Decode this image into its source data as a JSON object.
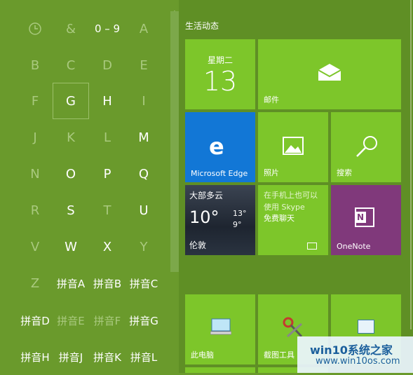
{
  "alphabet_grid": {
    "rows": [
      [
        {
          "t": "clock-icon",
          "dim": true,
          "icon": true
        },
        {
          "t": "&",
          "dim": true
        },
        {
          "t": "0 – 9",
          "dim": false
        },
        {
          "t": "A",
          "dim": true
        }
      ],
      [
        {
          "t": "B",
          "dim": true
        },
        {
          "t": "C",
          "dim": true
        },
        {
          "t": "D",
          "dim": true
        },
        {
          "t": "E",
          "dim": true
        }
      ],
      [
        {
          "t": "F",
          "dim": true
        },
        {
          "t": "G",
          "dim": false,
          "sel": true
        },
        {
          "t": "H",
          "dim": false
        },
        {
          "t": "I",
          "dim": true
        }
      ],
      [
        {
          "t": "J",
          "dim": true
        },
        {
          "t": "K",
          "dim": true
        },
        {
          "t": "L",
          "dim": true
        },
        {
          "t": "M",
          "dim": false
        }
      ],
      [
        {
          "t": "N",
          "dim": true
        },
        {
          "t": "O",
          "dim": false
        },
        {
          "t": "P",
          "dim": false
        },
        {
          "t": "Q",
          "dim": false
        }
      ],
      [
        {
          "t": "R",
          "dim": true
        },
        {
          "t": "S",
          "dim": false
        },
        {
          "t": "T",
          "dim": true
        },
        {
          "t": "U",
          "dim": false
        }
      ],
      [
        {
          "t": "V",
          "dim": true
        },
        {
          "t": "W",
          "dim": false
        },
        {
          "t": "X",
          "dim": false
        },
        {
          "t": "Y",
          "dim": true
        }
      ],
      [
        {
          "t": "Z",
          "dim": true
        },
        {
          "t": "拼音A",
          "dim": false
        },
        {
          "t": "拼音B",
          "dim": false
        },
        {
          "t": "拼音C",
          "dim": false
        }
      ],
      [
        {
          "t": "拼音D",
          "dim": false
        },
        {
          "t": "拼音E",
          "dim": true
        },
        {
          "t": "拼音F",
          "dim": true
        },
        {
          "t": "拼音G",
          "dim": false
        }
      ],
      [
        {
          "t": "拼音H",
          "dim": false
        },
        {
          "t": "拼音J",
          "dim": false
        },
        {
          "t": "拼音K",
          "dim": false
        },
        {
          "t": "拼音L",
          "dim": false
        }
      ]
    ]
  },
  "tiles": {
    "section_title": "生活动态",
    "calendar": {
      "day": "星期二",
      "date": "13"
    },
    "mail": {
      "label": "邮件"
    },
    "edge": {
      "label": "Microsoft Edge"
    },
    "photos": {
      "label": "照片"
    },
    "search": {
      "label": "搜索"
    },
    "weather": {
      "condition": "大部多云",
      "temp": "10°",
      "high": "13°",
      "low": "9°",
      "city": "伦敦"
    },
    "skype": {
      "line1": "在手机上也可以",
      "line2": "使用 Skype",
      "line3": "免费聊天"
    },
    "onenote": {
      "label": "OneNote"
    },
    "this_pc": {
      "label": "此电脑"
    },
    "snipping": {
      "label": "截图工具"
    }
  },
  "watermark": {
    "title": "win10系统之家",
    "url": "www.win10os.com"
  },
  "colors": {
    "bg_left": "#6a9a2c",
    "bg_right": "#5f8f25",
    "tile_green": "#7dc62a",
    "tile_blue": "#1277d6",
    "tile_purple": "#80397b",
    "tile_weather": "#1e2530"
  }
}
